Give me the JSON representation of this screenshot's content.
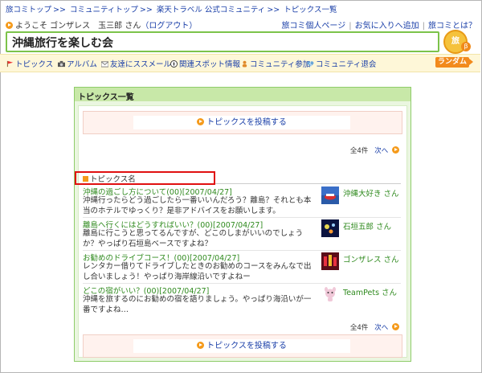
{
  "breadcrumb": {
    "items": [
      "旅コミトップ",
      "コミュニティトップ",
      "楽天トラベル 公式コミュニティ",
      "トピックス一覧"
    ],
    "separator": ">>"
  },
  "welcome": {
    "text": "ようこそ ゴンザレス　玉三郎 さん",
    "logout_label": "（ログアウト）"
  },
  "top_links": [
    "旅コミ個人ページ",
    "お気に入りへ追加",
    "旅コミとは？"
  ],
  "community_title": "沖縄旅行を楽しむ会",
  "logo_text": "旅",
  "nav": {
    "items": [
      {
        "label": "トピックス",
        "icon": "flag-icon"
      },
      {
        "label": "アルバム",
        "icon": "camera-icon"
      },
      {
        "label": "友達にススメール",
        "icon": "mail-icon"
      },
      {
        "label": "関連スポット情報",
        "icon": "compass-icon"
      },
      {
        "label": "コミュニティ参加",
        "icon": "person-icon"
      },
      {
        "label": "コミュニティ退会",
        "icon": "broken-heart-icon"
      }
    ],
    "random_label": "ランダム"
  },
  "panel": {
    "title": "トピックス一覧",
    "post_button": "トピックスを投稿する",
    "count_label": "全4件",
    "next_label": "次へ",
    "column_header": "トピックス名"
  },
  "topics": [
    {
      "title": "沖縄の過ごし方について(00)[2007/04/27]",
      "body": "沖縄行ったらどう過ごしたら一番いいんだろう？離島？それとも本当のホテルでゆっくり？是非アドバイスをお願いします。",
      "author": "沖縄大好き さん",
      "thumb": "sea-photo"
    },
    {
      "title": "離島へ行くにはどうすればいい？(00)[2007/04/27]",
      "body": "離島に行こうと思ってるんですが、どこのしまがいいのでしょうか？やっぱり石垣島ベースですよね？",
      "author": "石垣五郎 さん",
      "thumb": "night-photo"
    },
    {
      "title": "お勧めのドライブコース！(00)[2007/04/27]",
      "body": "レンタカー借りてドライブしたときのお勧めのコースをみんなで出し合いましょう！やっぱり海岸線沿いですよねー",
      "author": "ゴンザレス さん",
      "thumb": "festival-photo"
    },
    {
      "title": "どこの宿がいい？(00)[2007/04/27]",
      "body": "沖縄を旅するのにお勧めの宿を語りましょう。やっぱり海沿いが一番ですよね…",
      "author": "TeamPets さん",
      "thumb": "pet-photo"
    }
  ],
  "colors": {
    "link": "#1a3fa8",
    "green_text": "#2f8a1e",
    "panel_border": "#8fcc6a",
    "accent_orange": "#f28a1c",
    "highlight_red": "#e01010"
  }
}
